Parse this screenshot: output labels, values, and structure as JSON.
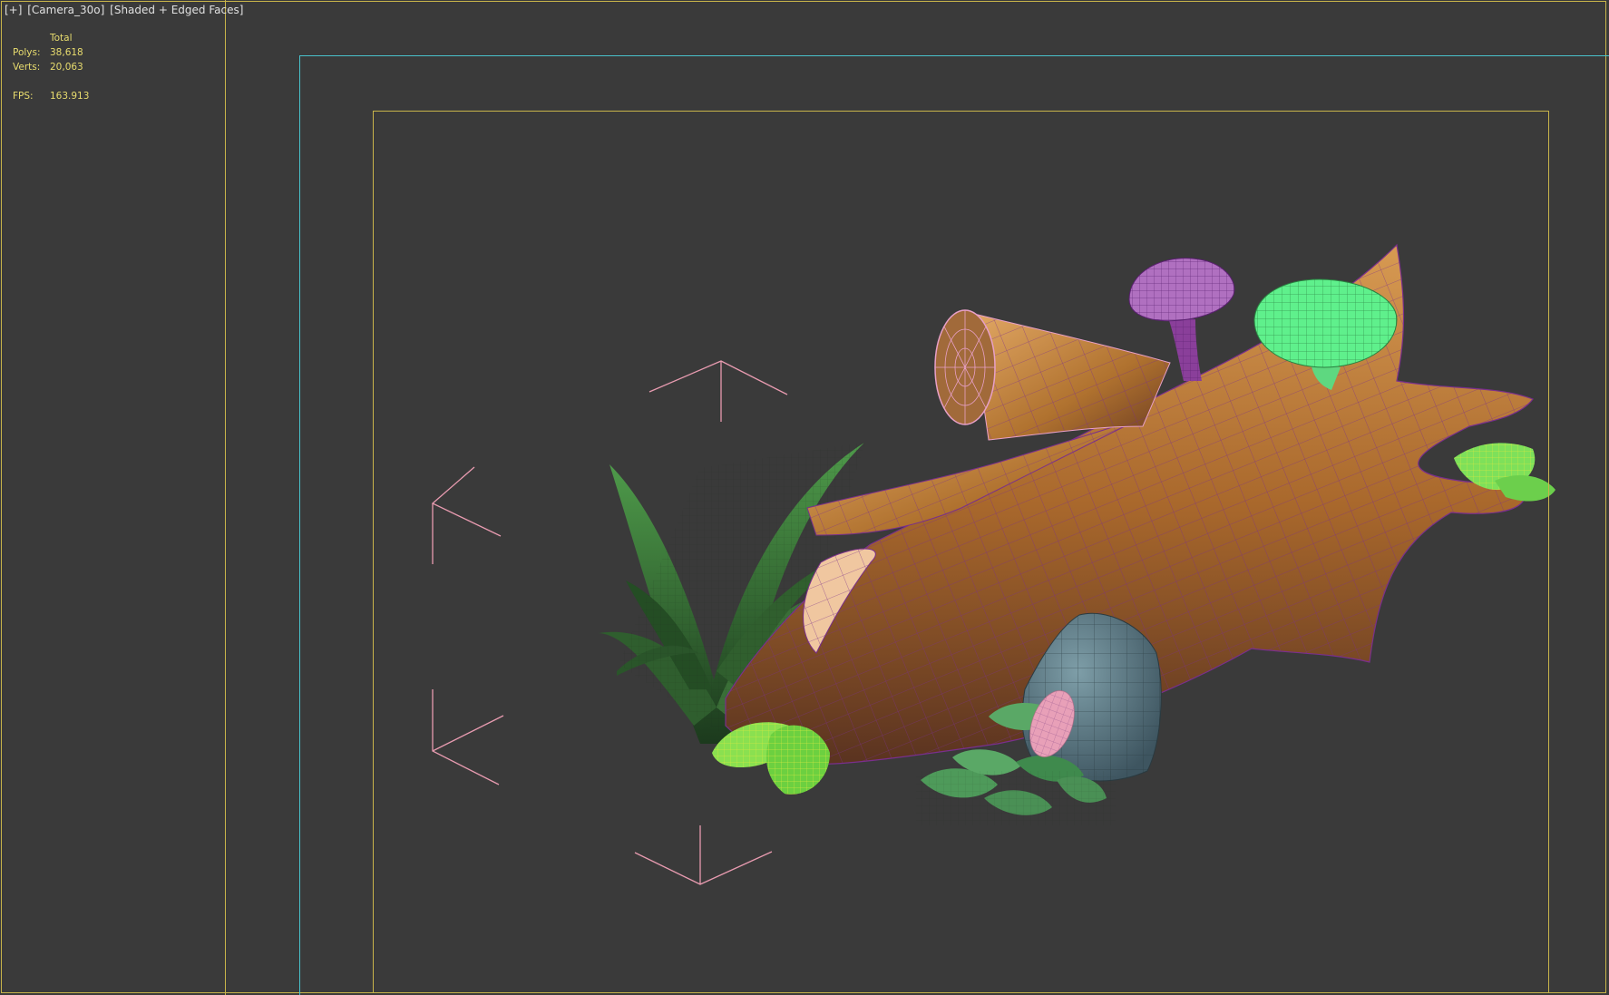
{
  "viewport": {
    "label_parts": [
      "[+]",
      "[Camera_30o]",
      "[Shaded + Edged Faces]"
    ]
  },
  "stats": {
    "header": "Total",
    "polys_label": "Polys:",
    "polys_value": "38,618",
    "verts_label": "Verts:",
    "verts_value": "20,063",
    "fps_label": "FPS:",
    "fps_value": "163.913"
  },
  "colors": {
    "viewport_bg": "#3a3a3a",
    "frame_yellow": "#c8b44a",
    "frame_cyan": "#49c2cc",
    "stat_text": "#e8dc6e",
    "wood": "#b8752f",
    "wireframe_purple": "#8a3fa0",
    "grass": "#3f7d3b",
    "mushroom_green": "#5ff08c",
    "mushroom_purple": "#b874c8",
    "rock": "#5e7c88",
    "selection_bracket": "#e89bb0"
  },
  "scene_objects": [
    "log-trunk",
    "cut-log",
    "purple-mushroom",
    "green-mushroom",
    "grass-tuft",
    "rock",
    "leaf-cluster",
    "pink-bud",
    "yellow-green-leaves"
  ]
}
